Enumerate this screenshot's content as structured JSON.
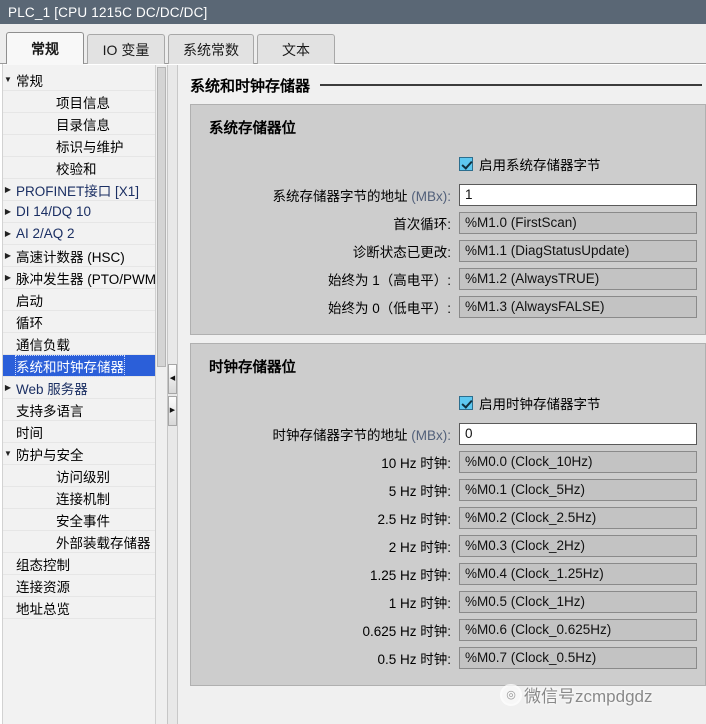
{
  "window": {
    "title": "PLC_1 [CPU 1215C DC/DC/DC]"
  },
  "tabs": [
    {
      "label": "常规",
      "active": true
    },
    {
      "label": "IO 变量",
      "active": false
    },
    {
      "label": "系统常数",
      "active": false
    },
    {
      "label": "文本",
      "active": false
    }
  ],
  "sidebar": {
    "items": [
      {
        "label": "常规",
        "depth": 1,
        "arrow": "▼",
        "selected": false,
        "blue": false
      },
      {
        "label": "项目信息",
        "depth": 2,
        "arrow": "",
        "selected": false,
        "blue": false
      },
      {
        "label": "目录信息",
        "depth": 2,
        "arrow": "",
        "selected": false,
        "blue": false
      },
      {
        "label": "标识与维护",
        "depth": 2,
        "arrow": "",
        "selected": false,
        "blue": false
      },
      {
        "label": "校验和",
        "depth": 2,
        "arrow": "",
        "selected": false,
        "blue": false
      },
      {
        "label": "PROFINET接口 [X1]",
        "depth": 1,
        "arrow": "▶",
        "selected": false,
        "blue": true
      },
      {
        "label": "DI 14/DQ 10",
        "depth": 1,
        "arrow": "▶",
        "selected": false,
        "blue": true
      },
      {
        "label": "AI 2/AQ 2",
        "depth": 1,
        "arrow": "▶",
        "selected": false,
        "blue": true
      },
      {
        "label": "高速计数器 (HSC)",
        "depth": 1,
        "arrow": "▶",
        "selected": false,
        "blue": false
      },
      {
        "label": "脉冲发生器 (PTO/PWM)",
        "depth": 1,
        "arrow": "▶",
        "selected": false,
        "blue": false
      },
      {
        "label": "启动",
        "depth": 1,
        "arrow": "",
        "selected": false,
        "blue": false
      },
      {
        "label": "循环",
        "depth": 1,
        "arrow": "",
        "selected": false,
        "blue": false
      },
      {
        "label": "通信负载",
        "depth": 1,
        "arrow": "",
        "selected": false,
        "blue": false
      },
      {
        "label": "系统和时钟存储器",
        "depth": 1,
        "arrow": "",
        "selected": true,
        "blue": false
      },
      {
        "label": "Web 服务器",
        "depth": 1,
        "arrow": "▶",
        "selected": false,
        "blue": true
      },
      {
        "label": "支持多语言",
        "depth": 1,
        "arrow": "",
        "selected": false,
        "blue": false
      },
      {
        "label": "时间",
        "depth": 1,
        "arrow": "",
        "selected": false,
        "blue": false
      },
      {
        "label": "防护与安全",
        "depth": 1,
        "arrow": "▼",
        "selected": false,
        "blue": false
      },
      {
        "label": "访问级别",
        "depth": 2,
        "arrow": "",
        "selected": false,
        "blue": false
      },
      {
        "label": "连接机制",
        "depth": 2,
        "arrow": "",
        "selected": false,
        "blue": false
      },
      {
        "label": "安全事件",
        "depth": 2,
        "arrow": "",
        "selected": false,
        "blue": false
      },
      {
        "label": "外部装载存储器",
        "depth": 2,
        "arrow": "",
        "selected": false,
        "blue": false
      },
      {
        "label": "组态控制",
        "depth": 1,
        "arrow": "",
        "selected": false,
        "blue": false
      },
      {
        "label": "连接资源",
        "depth": 1,
        "arrow": "",
        "selected": false,
        "blue": false
      },
      {
        "label": "地址总览",
        "depth": 1,
        "arrow": "",
        "selected": false,
        "blue": false
      }
    ],
    "collapse_left_icon": "◀",
    "collapse_right_icon": "▶"
  },
  "main": {
    "page_title": "系统和时钟存储器",
    "system_group": {
      "title": "系统存储器位",
      "enable_label": "启用系统存储器字节",
      "enabled": true,
      "address_label": "系统存储器字节的地址",
      "address_unit": "(MBx):",
      "address_value": "1",
      "rows": [
        {
          "label": "首次循环:",
          "value": "%M1.0 (FirstScan)"
        },
        {
          "label": "诊断状态已更改:",
          "value": "%M1.1 (DiagStatusUpdate)"
        },
        {
          "label": "始终为 1（高电平）:",
          "value": "%M1.2 (AlwaysTRUE)"
        },
        {
          "label": "始终为 0（低电平）:",
          "value": "%M1.3 (AlwaysFALSE)"
        }
      ]
    },
    "clock_group": {
      "title": "时钟存储器位",
      "enable_label": "启用时钟存储器字节",
      "enabled": true,
      "address_label": "时钟存储器字节的地址",
      "address_unit": "(MBx):",
      "address_value": "0",
      "rows": [
        {
          "label": "10 Hz 时钟:",
          "value": "%M0.0 (Clock_10Hz)"
        },
        {
          "label": "5 Hz 时钟:",
          "value": "%M0.1 (Clock_5Hz)"
        },
        {
          "label": "2.5 Hz 时钟:",
          "value": "%M0.2 (Clock_2.5Hz)"
        },
        {
          "label": "2 Hz 时钟:",
          "value": "%M0.3 (Clock_2Hz)"
        },
        {
          "label": "1.25 Hz 时钟:",
          "value": "%M0.4 (Clock_1.25Hz)"
        },
        {
          "label": "1 Hz 时钟:",
          "value": "%M0.5 (Clock_1Hz)"
        },
        {
          "label": "0.625 Hz 时钟:",
          "value": "%M0.6 (Clock_0.625Hz)"
        },
        {
          "label": "0.5 Hz 时钟:",
          "value": "%M0.7 (Clock_0.5Hz)"
        }
      ]
    }
  },
  "watermark": {
    "text": "微信号zcmpdgdz"
  },
  "colors": {
    "titlebar": "#5a6775",
    "selection": "#2b5fd9",
    "group_bg": "#cdcdcd",
    "checkbox": "#5ec8f0",
    "unit_text": "#52607a"
  }
}
